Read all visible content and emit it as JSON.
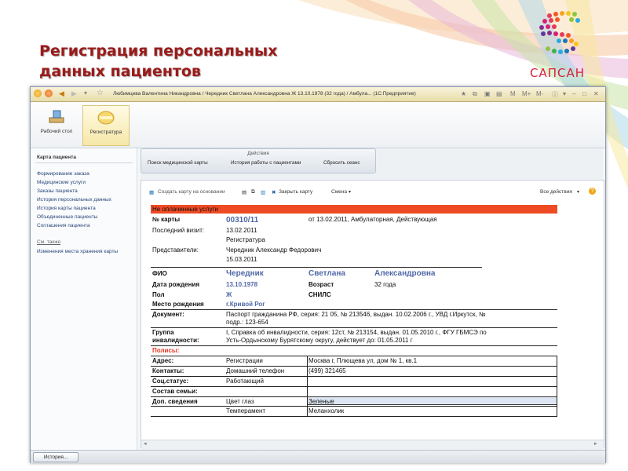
{
  "slide": {
    "title_line1": "Регистрация персональных",
    "title_line2": "данных пациентов",
    "logo_text": "САПСАН"
  },
  "window": {
    "title": "Любимцева Валентина Никандровна / Чередник Светлана Александровна Ж 13.10.1978 (32 года) / Амбула... (1С:Предприятие)"
  },
  "sections": [
    {
      "label": "Рабочий стол",
      "icon": "desktop-icon"
    },
    {
      "label": "Регистратура",
      "icon": "registry-icon"
    }
  ],
  "left_panel": {
    "header": "Карта пациента",
    "items": [
      "Формирование заказа",
      "Медицинские услуги",
      "Заказы пациента",
      "История персональных данных",
      "История карты пациента",
      "Объединенные пациенты",
      "Соглашения пациента"
    ],
    "see_also": "См. также",
    "see_also_items": [
      "Изменения места хранения карты"
    ]
  },
  "actions": {
    "title": "Действия",
    "buttons": [
      "Поиск медицинской карты",
      "История работы с пациентами",
      "Сбросить сеанс"
    ]
  },
  "command_bar": {
    "create": "Создать карту на основании",
    "close": "Закрыть карту",
    "change": "Смена",
    "all_actions": "Все действия",
    "help": "?"
  },
  "card": {
    "banner": "Не оплаченные услуги",
    "card_no_label": "№ карты",
    "card_no": "00310/11",
    "card_info": "от 13.02.2011, Амбулаторная, Действующая",
    "last_visit_label": "Последний визит:",
    "last_visit_date": "13.02.2011",
    "last_visit_place": "Регистратура",
    "reps_label": "Представители:",
    "reps_name": "Чередник Александр Федорович",
    "reps_date": "15.03.2011",
    "fio_label": "ФИО",
    "last_name": "Чередник",
    "first_name": "Светлана",
    "middle_name": "Александровна",
    "dob_label": "Дата рождения",
    "dob": "13.10.1978",
    "age_label": "Возраст",
    "age": "32 года",
    "sex_label": "Пол",
    "sex": "Ж",
    "snils_label": "СНИЛС",
    "birthplace_label": "Место рождения",
    "birthplace": "г.Кривой Рог",
    "document_label": "Документ:",
    "document_line1": "Паспорт гражданина РФ, серия: 21 05, № 213546, выдан. 10.02.2006 г., УВД г.Иркутск, №",
    "document_line2": "подр.: 123-654",
    "disability_label_1": "Группа",
    "disability_label_2": "инвалидности:",
    "disability_line1": "I, Справка об инвалидности, серия: 12ст, № 213154, выдан. 01.05.2010 г., ФГУ ГБМСЭ по",
    "disability_line2": "Усть-Ордынскому Бурятскому округу, действует до: 01.05.2011 г",
    "policies_label": "Полисы:",
    "address_label": "Адрес:",
    "address_type": "Регистрации",
    "address_value": "Москва г, Плющева ул, дом № 1, кв.1",
    "contacts_label": "Контакты:",
    "contacts_type": "Домашний телефон",
    "contacts_value": "(499) 321465",
    "social_label": "Соц.статус:",
    "social_value": "Работающий",
    "family_label": "Состав семьи:",
    "extra_label": "Доп. сведения",
    "eye_label": "Цвет глаз",
    "eye_value": "Зеленые",
    "temper_label": "Темперамент",
    "temper_value": "Меланхолик"
  },
  "status_bar": {
    "history": "История..."
  },
  "colors": {
    "title_red": "#9b1a1a",
    "banner_red": "#ee4b25",
    "value_blue": "#4f68a8",
    "logo_red": "#d81e3a"
  }
}
